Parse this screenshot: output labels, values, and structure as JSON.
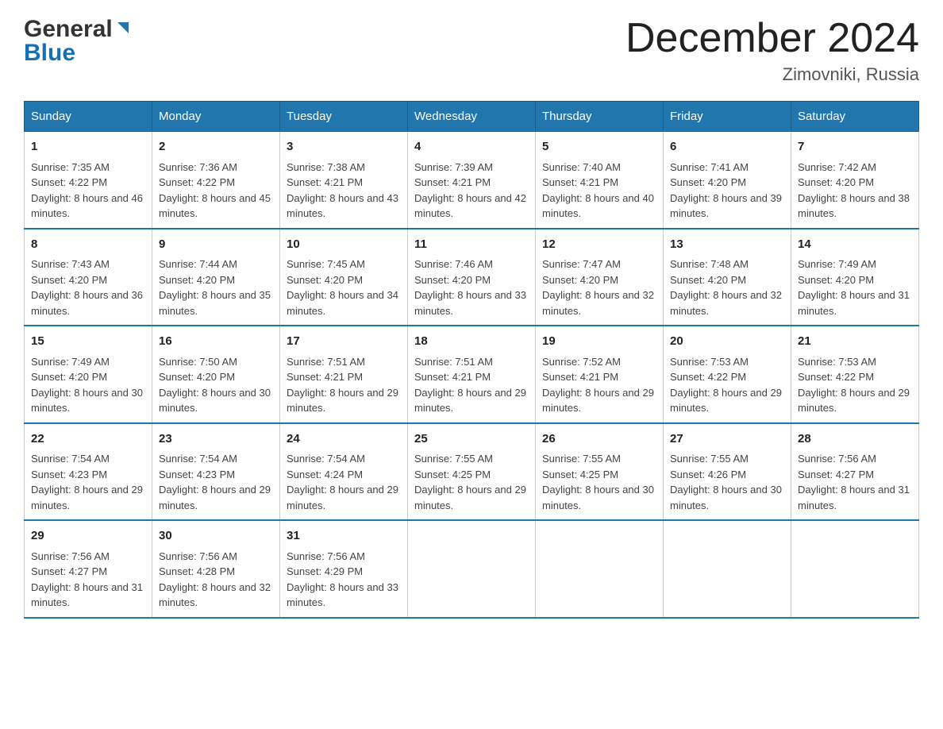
{
  "header": {
    "logo_general": "General",
    "logo_blue": "Blue",
    "month_title": "December 2024",
    "location": "Zimovniki, Russia"
  },
  "weekdays": [
    "Sunday",
    "Monday",
    "Tuesday",
    "Wednesday",
    "Thursday",
    "Friday",
    "Saturday"
  ],
  "weeks": [
    [
      {
        "day": "1",
        "sunrise": "7:35 AM",
        "sunset": "4:22 PM",
        "daylight": "8 hours and 46 minutes."
      },
      {
        "day": "2",
        "sunrise": "7:36 AM",
        "sunset": "4:22 PM",
        "daylight": "8 hours and 45 minutes."
      },
      {
        "day": "3",
        "sunrise": "7:38 AM",
        "sunset": "4:21 PM",
        "daylight": "8 hours and 43 minutes."
      },
      {
        "day": "4",
        "sunrise": "7:39 AM",
        "sunset": "4:21 PM",
        "daylight": "8 hours and 42 minutes."
      },
      {
        "day": "5",
        "sunrise": "7:40 AM",
        "sunset": "4:21 PM",
        "daylight": "8 hours and 40 minutes."
      },
      {
        "day": "6",
        "sunrise": "7:41 AM",
        "sunset": "4:20 PM",
        "daylight": "8 hours and 39 minutes."
      },
      {
        "day": "7",
        "sunrise": "7:42 AM",
        "sunset": "4:20 PM",
        "daylight": "8 hours and 38 minutes."
      }
    ],
    [
      {
        "day": "8",
        "sunrise": "7:43 AM",
        "sunset": "4:20 PM",
        "daylight": "8 hours and 36 minutes."
      },
      {
        "day": "9",
        "sunrise": "7:44 AM",
        "sunset": "4:20 PM",
        "daylight": "8 hours and 35 minutes."
      },
      {
        "day": "10",
        "sunrise": "7:45 AM",
        "sunset": "4:20 PM",
        "daylight": "8 hours and 34 minutes."
      },
      {
        "day": "11",
        "sunrise": "7:46 AM",
        "sunset": "4:20 PM",
        "daylight": "8 hours and 33 minutes."
      },
      {
        "day": "12",
        "sunrise": "7:47 AM",
        "sunset": "4:20 PM",
        "daylight": "8 hours and 32 minutes."
      },
      {
        "day": "13",
        "sunrise": "7:48 AM",
        "sunset": "4:20 PM",
        "daylight": "8 hours and 32 minutes."
      },
      {
        "day": "14",
        "sunrise": "7:49 AM",
        "sunset": "4:20 PM",
        "daylight": "8 hours and 31 minutes."
      }
    ],
    [
      {
        "day": "15",
        "sunrise": "7:49 AM",
        "sunset": "4:20 PM",
        "daylight": "8 hours and 30 minutes."
      },
      {
        "day": "16",
        "sunrise": "7:50 AM",
        "sunset": "4:20 PM",
        "daylight": "8 hours and 30 minutes."
      },
      {
        "day": "17",
        "sunrise": "7:51 AM",
        "sunset": "4:21 PM",
        "daylight": "8 hours and 29 minutes."
      },
      {
        "day": "18",
        "sunrise": "7:51 AM",
        "sunset": "4:21 PM",
        "daylight": "8 hours and 29 minutes."
      },
      {
        "day": "19",
        "sunrise": "7:52 AM",
        "sunset": "4:21 PM",
        "daylight": "8 hours and 29 minutes."
      },
      {
        "day": "20",
        "sunrise": "7:53 AM",
        "sunset": "4:22 PM",
        "daylight": "8 hours and 29 minutes."
      },
      {
        "day": "21",
        "sunrise": "7:53 AM",
        "sunset": "4:22 PM",
        "daylight": "8 hours and 29 minutes."
      }
    ],
    [
      {
        "day": "22",
        "sunrise": "7:54 AM",
        "sunset": "4:23 PM",
        "daylight": "8 hours and 29 minutes."
      },
      {
        "day": "23",
        "sunrise": "7:54 AM",
        "sunset": "4:23 PM",
        "daylight": "8 hours and 29 minutes."
      },
      {
        "day": "24",
        "sunrise": "7:54 AM",
        "sunset": "4:24 PM",
        "daylight": "8 hours and 29 minutes."
      },
      {
        "day": "25",
        "sunrise": "7:55 AM",
        "sunset": "4:25 PM",
        "daylight": "8 hours and 29 minutes."
      },
      {
        "day": "26",
        "sunrise": "7:55 AM",
        "sunset": "4:25 PM",
        "daylight": "8 hours and 30 minutes."
      },
      {
        "day": "27",
        "sunrise": "7:55 AM",
        "sunset": "4:26 PM",
        "daylight": "8 hours and 30 minutes."
      },
      {
        "day": "28",
        "sunrise": "7:56 AM",
        "sunset": "4:27 PM",
        "daylight": "8 hours and 31 minutes."
      }
    ],
    [
      {
        "day": "29",
        "sunrise": "7:56 AM",
        "sunset": "4:27 PM",
        "daylight": "8 hours and 31 minutes."
      },
      {
        "day": "30",
        "sunrise": "7:56 AM",
        "sunset": "4:28 PM",
        "daylight": "8 hours and 32 minutes."
      },
      {
        "day": "31",
        "sunrise": "7:56 AM",
        "sunset": "4:29 PM",
        "daylight": "8 hours and 33 minutes."
      },
      null,
      null,
      null,
      null
    ]
  ],
  "sunrise_label": "Sunrise:",
  "sunset_label": "Sunset:",
  "daylight_label": "Daylight:"
}
